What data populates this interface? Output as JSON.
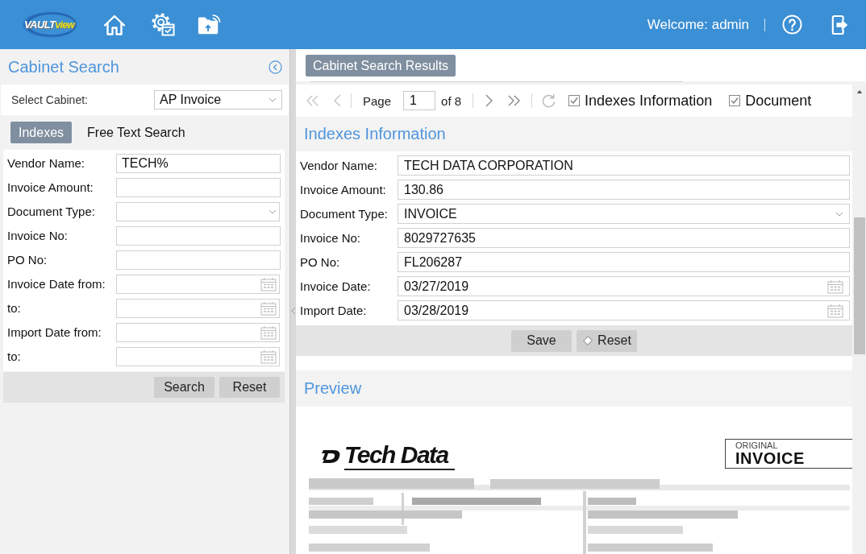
{
  "header": {
    "logo": {
      "main": "VAULT",
      "accent": "view"
    },
    "welcome": "Welcome: admin"
  },
  "cabinet_search": {
    "title": "Cabinet Search",
    "select_cabinet": {
      "label": "Select Cabinet:",
      "value": "AP Invoice"
    },
    "tabs": [
      {
        "label": "Indexes",
        "selected": true
      },
      {
        "label": "Free Text Search",
        "selected": false
      }
    ],
    "fields": [
      {
        "label": "Vendor Name:",
        "kind": "text",
        "value": "TECH%"
      },
      {
        "label": "Invoice Amount:",
        "kind": "text"
      },
      {
        "label": "Document Type:",
        "kind": "select"
      },
      {
        "label": "Invoice No:",
        "kind": "text"
      },
      {
        "label": "PO No:",
        "kind": "text"
      },
      {
        "label": "Invoice Date from:",
        "kind": "date"
      },
      {
        "label": "to:",
        "kind": "date"
      },
      {
        "label": "Import Date from:",
        "kind": "date"
      },
      {
        "label": "to:",
        "kind": "date"
      }
    ],
    "buttons": [
      "Search",
      "Reset"
    ]
  },
  "results": {
    "tab": {
      "label": "Cabinet Search Results",
      "selected": true
    },
    "pager": {
      "nav": [
        {
          "kind": "first",
          "disabled": true
        },
        {
          "kind": "prev",
          "disabled": true
        },
        {
          "kind": "next",
          "disabled": false
        },
        {
          "kind": "last",
          "disabled": false
        }
      ],
      "page_label": "Page",
      "page": "1",
      "of_total": "of 8"
    },
    "toggles": [
      {
        "label": "Indexes Information",
        "checked": true
      },
      {
        "label": "Document",
        "checked": true
      }
    ],
    "indexes": {
      "title": "Indexes Information",
      "fields": [
        {
          "label": "Vendor Name:",
          "kind": "text",
          "value": "TECH DATA CORPORATION"
        },
        {
          "label": "Invoice Amount:",
          "kind": "text",
          "value": "130.86"
        },
        {
          "label": "Document Type:",
          "kind": "select",
          "value": "INVOICE"
        },
        {
          "label": "Invoice No:",
          "kind": "text",
          "value": "8029727635"
        },
        {
          "label": "PO No:",
          "kind": "text",
          "value": "FL206287"
        },
        {
          "label": "Invoice Date:",
          "kind": "date",
          "value": "03/27/2019"
        },
        {
          "label": "Import Date:",
          "kind": "date",
          "value": "03/28/2019"
        }
      ],
      "buttons": [
        {
          "label": "Save",
          "kind": "plain"
        },
        {
          "label": "Reset",
          "kind": "eraser"
        }
      ]
    },
    "preview": {
      "title": "Preview",
      "document": {
        "logo_text": "Tech Data",
        "stamp_small": "ORIGINAL",
        "stamp_large": "INVOICE"
      }
    }
  }
}
